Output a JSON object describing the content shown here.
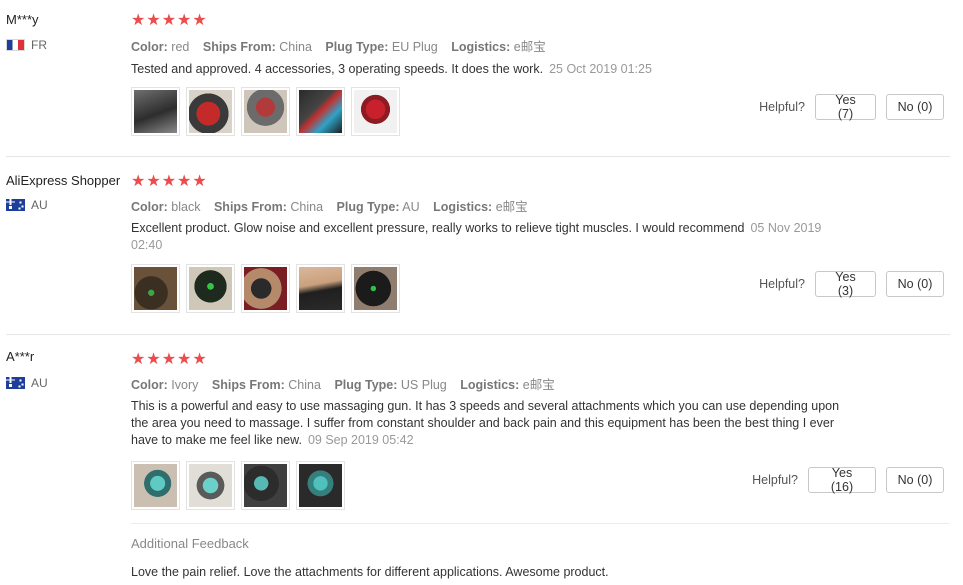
{
  "reviews": [
    {
      "name": "M***y",
      "country": "FR",
      "stars": "★★★★★",
      "rating": 5,
      "properties": [
        {
          "label": "Color:",
          "value": "red"
        },
        {
          "label": "Ships From:",
          "value": "China"
        },
        {
          "label": "Plug Type:",
          "value": "EU Plug"
        },
        {
          "label": "Logistics:",
          "value": "e邮宝"
        }
      ],
      "text": "Tested and approved. 4 accessories, 3 operating speeds. It does the work.",
      "date": "25 Oct 2019 01:25",
      "helpful_label": "Helpful?",
      "yes": "Yes (7)",
      "no": "No (0)"
    },
    {
      "name": "AliExpress Shopper",
      "country": "AU",
      "stars": "★★★★★",
      "rating": 5,
      "properties": [
        {
          "label": "Color:",
          "value": "black"
        },
        {
          "label": "Ships From:",
          "value": "China"
        },
        {
          "label": "Plug Type:",
          "value": "AU"
        },
        {
          "label": "Logistics:",
          "value": "e邮宝"
        }
      ],
      "text": "Excellent product. Glow noise and excellent pressure, really works to relieve tight muscles. I would recommend",
      "date": "05 Nov 2019 02:40",
      "helpful_label": "Helpful?",
      "yes": "Yes (3)",
      "no": "No (0)"
    },
    {
      "name": "A***r",
      "country": "AU",
      "stars": "★★★★★",
      "rating": 5,
      "properties": [
        {
          "label": "Color:",
          "value": "Ivory"
        },
        {
          "label": "Ships From:",
          "value": "China"
        },
        {
          "label": "Plug Type:",
          "value": "US Plug"
        },
        {
          "label": "Logistics:",
          "value": "e邮宝"
        }
      ],
      "text": "This is a powerful and easy to use massaging gun. It has 3 speeds and several attachments which you can use depending upon the area you need to massage. I suffer from constant shoulder and back pain and this equipment has been the best thing I ever have to make me feel like new.",
      "date": "09 Sep 2019 05:42",
      "helpful_label": "Helpful?",
      "yes": "Yes (16)",
      "no": "No (0)",
      "additional_feedback_title": "Additional Feedback",
      "additional_feedback_text": "Love the pain relief. Love the attachments for different applications. Awesome product."
    }
  ],
  "colors": {
    "star": "#ec4c4c",
    "label": "#777777",
    "date": "#999999",
    "separator": "#e6e6e6"
  }
}
